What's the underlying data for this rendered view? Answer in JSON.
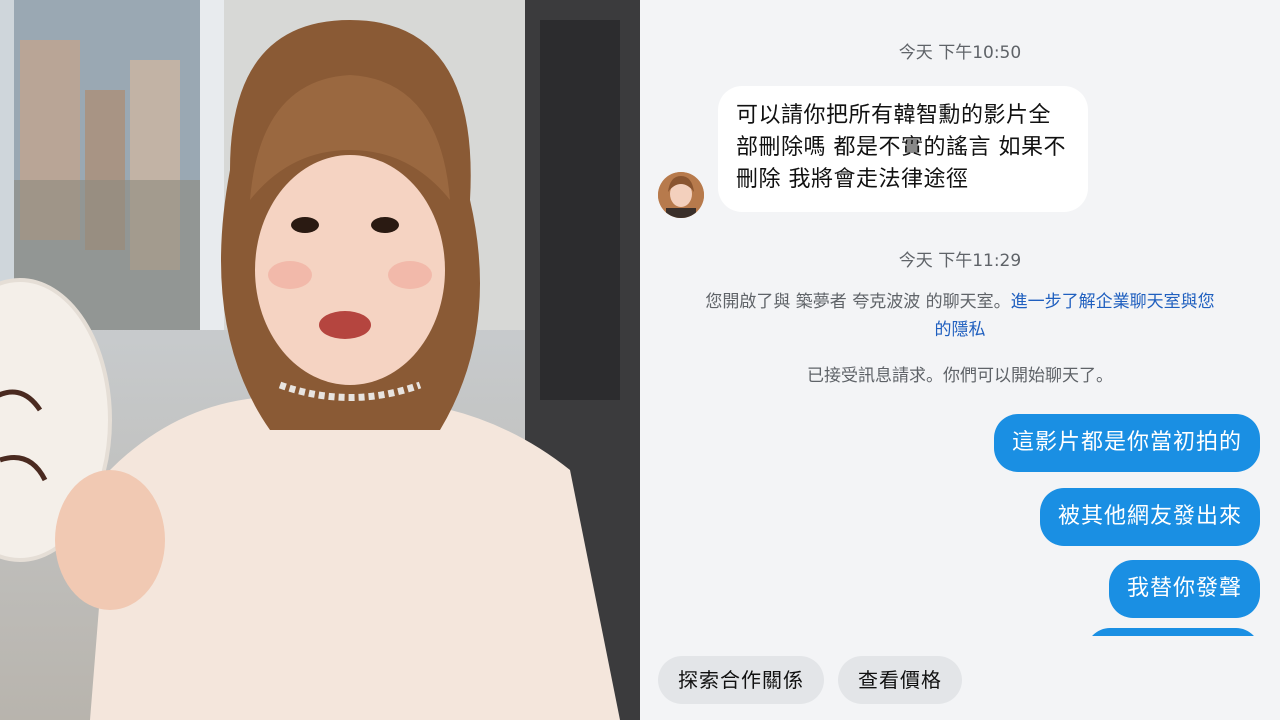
{
  "chat": {
    "timestamp_1": "今天 下午10:50",
    "incoming_message": "可以請你把所有韓智勳的影片全部刪除嗎 都是不實的謠言 如果不刪除 我將會走法律途徑",
    "timestamp_2": "今天 下午11:29",
    "system_notice_prefix": "您開啟了與 築夢者 夸克波波 的聊天室。",
    "system_notice_link": "進一步了解企業聊天室與您的隱私",
    "accepted_notice": "已接受訊息請求。你們可以開始聊天了。",
    "outgoing_messages": [
      "這影片都是你當初拍的",
      "被其他網友發出來",
      "我替你發聲"
    ]
  },
  "actions": {
    "explore_partnership": "探索合作關係",
    "view_pricing": "查看價格"
  },
  "colors": {
    "outgoing_bubble": "#1a8fe3",
    "incoming_bubble": "#ffffff",
    "chat_background": "#f3f4f6",
    "link": "#1f5fbf",
    "chip_background": "#e3e5e8"
  }
}
